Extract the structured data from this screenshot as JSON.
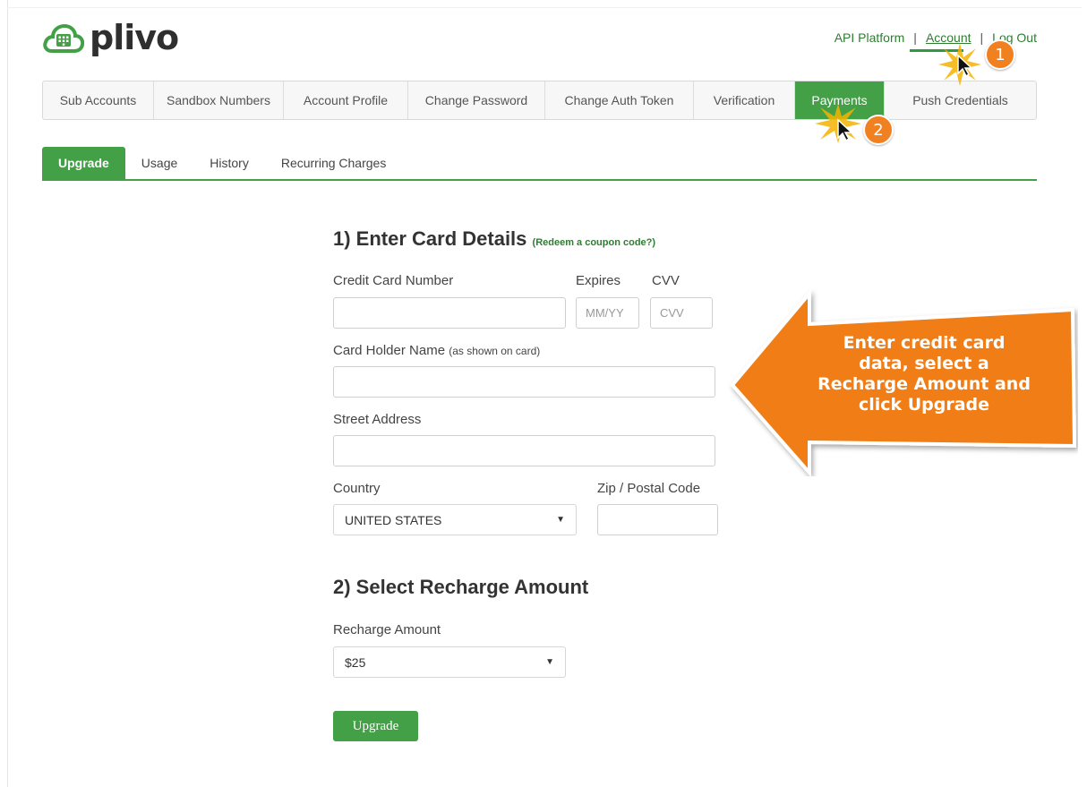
{
  "brand": {
    "name": "plivo"
  },
  "top_links": {
    "api_platform": "API Platform",
    "account": "Account",
    "logout": "Log Out",
    "separator": "|"
  },
  "nav": {
    "items": [
      {
        "label": "Sub Accounts"
      },
      {
        "label": "Sandbox Numbers"
      },
      {
        "label": "Account Profile"
      },
      {
        "label": "Change Password"
      },
      {
        "label": "Change Auth Token"
      },
      {
        "label": "Verification"
      },
      {
        "label": "Payments"
      },
      {
        "label": "Push Credentials"
      }
    ],
    "active": "Payments"
  },
  "subtabs": {
    "items": [
      {
        "label": "Upgrade"
      },
      {
        "label": "Usage"
      },
      {
        "label": "History"
      },
      {
        "label": "Recurring Charges"
      }
    ],
    "active": "Upgrade"
  },
  "form": {
    "section1_title": "1) Enter Card Details",
    "coupon_link": "(Redeem a coupon code?)",
    "card_number_label": "Credit Card Number",
    "card_number_value": "",
    "expires_label": "Expires",
    "expires_placeholder": "MM/YY",
    "cvv_label": "CVV",
    "cvv_placeholder": "CVV",
    "holder_label": "Card Holder Name",
    "holder_hint": "(as shown on card)",
    "holder_value": "",
    "street_label": "Street Address",
    "street_value": "",
    "country_label": "Country",
    "country_value": "UNITED STATES",
    "zip_label": "Zip / Postal Code",
    "zip_value": "",
    "section2_title": "2) Select Recharge Amount",
    "recharge_label": "Recharge Amount",
    "recharge_value": "$25",
    "submit_label": "Upgrade"
  },
  "annotation": {
    "callout": "Enter credit card data, select a Recharge Amount and click Upgrade",
    "step1": "1",
    "step2": "2",
    "color": "#f07d12"
  },
  "colors": {
    "accent": "#43a047",
    "link": "#2e7d32"
  }
}
